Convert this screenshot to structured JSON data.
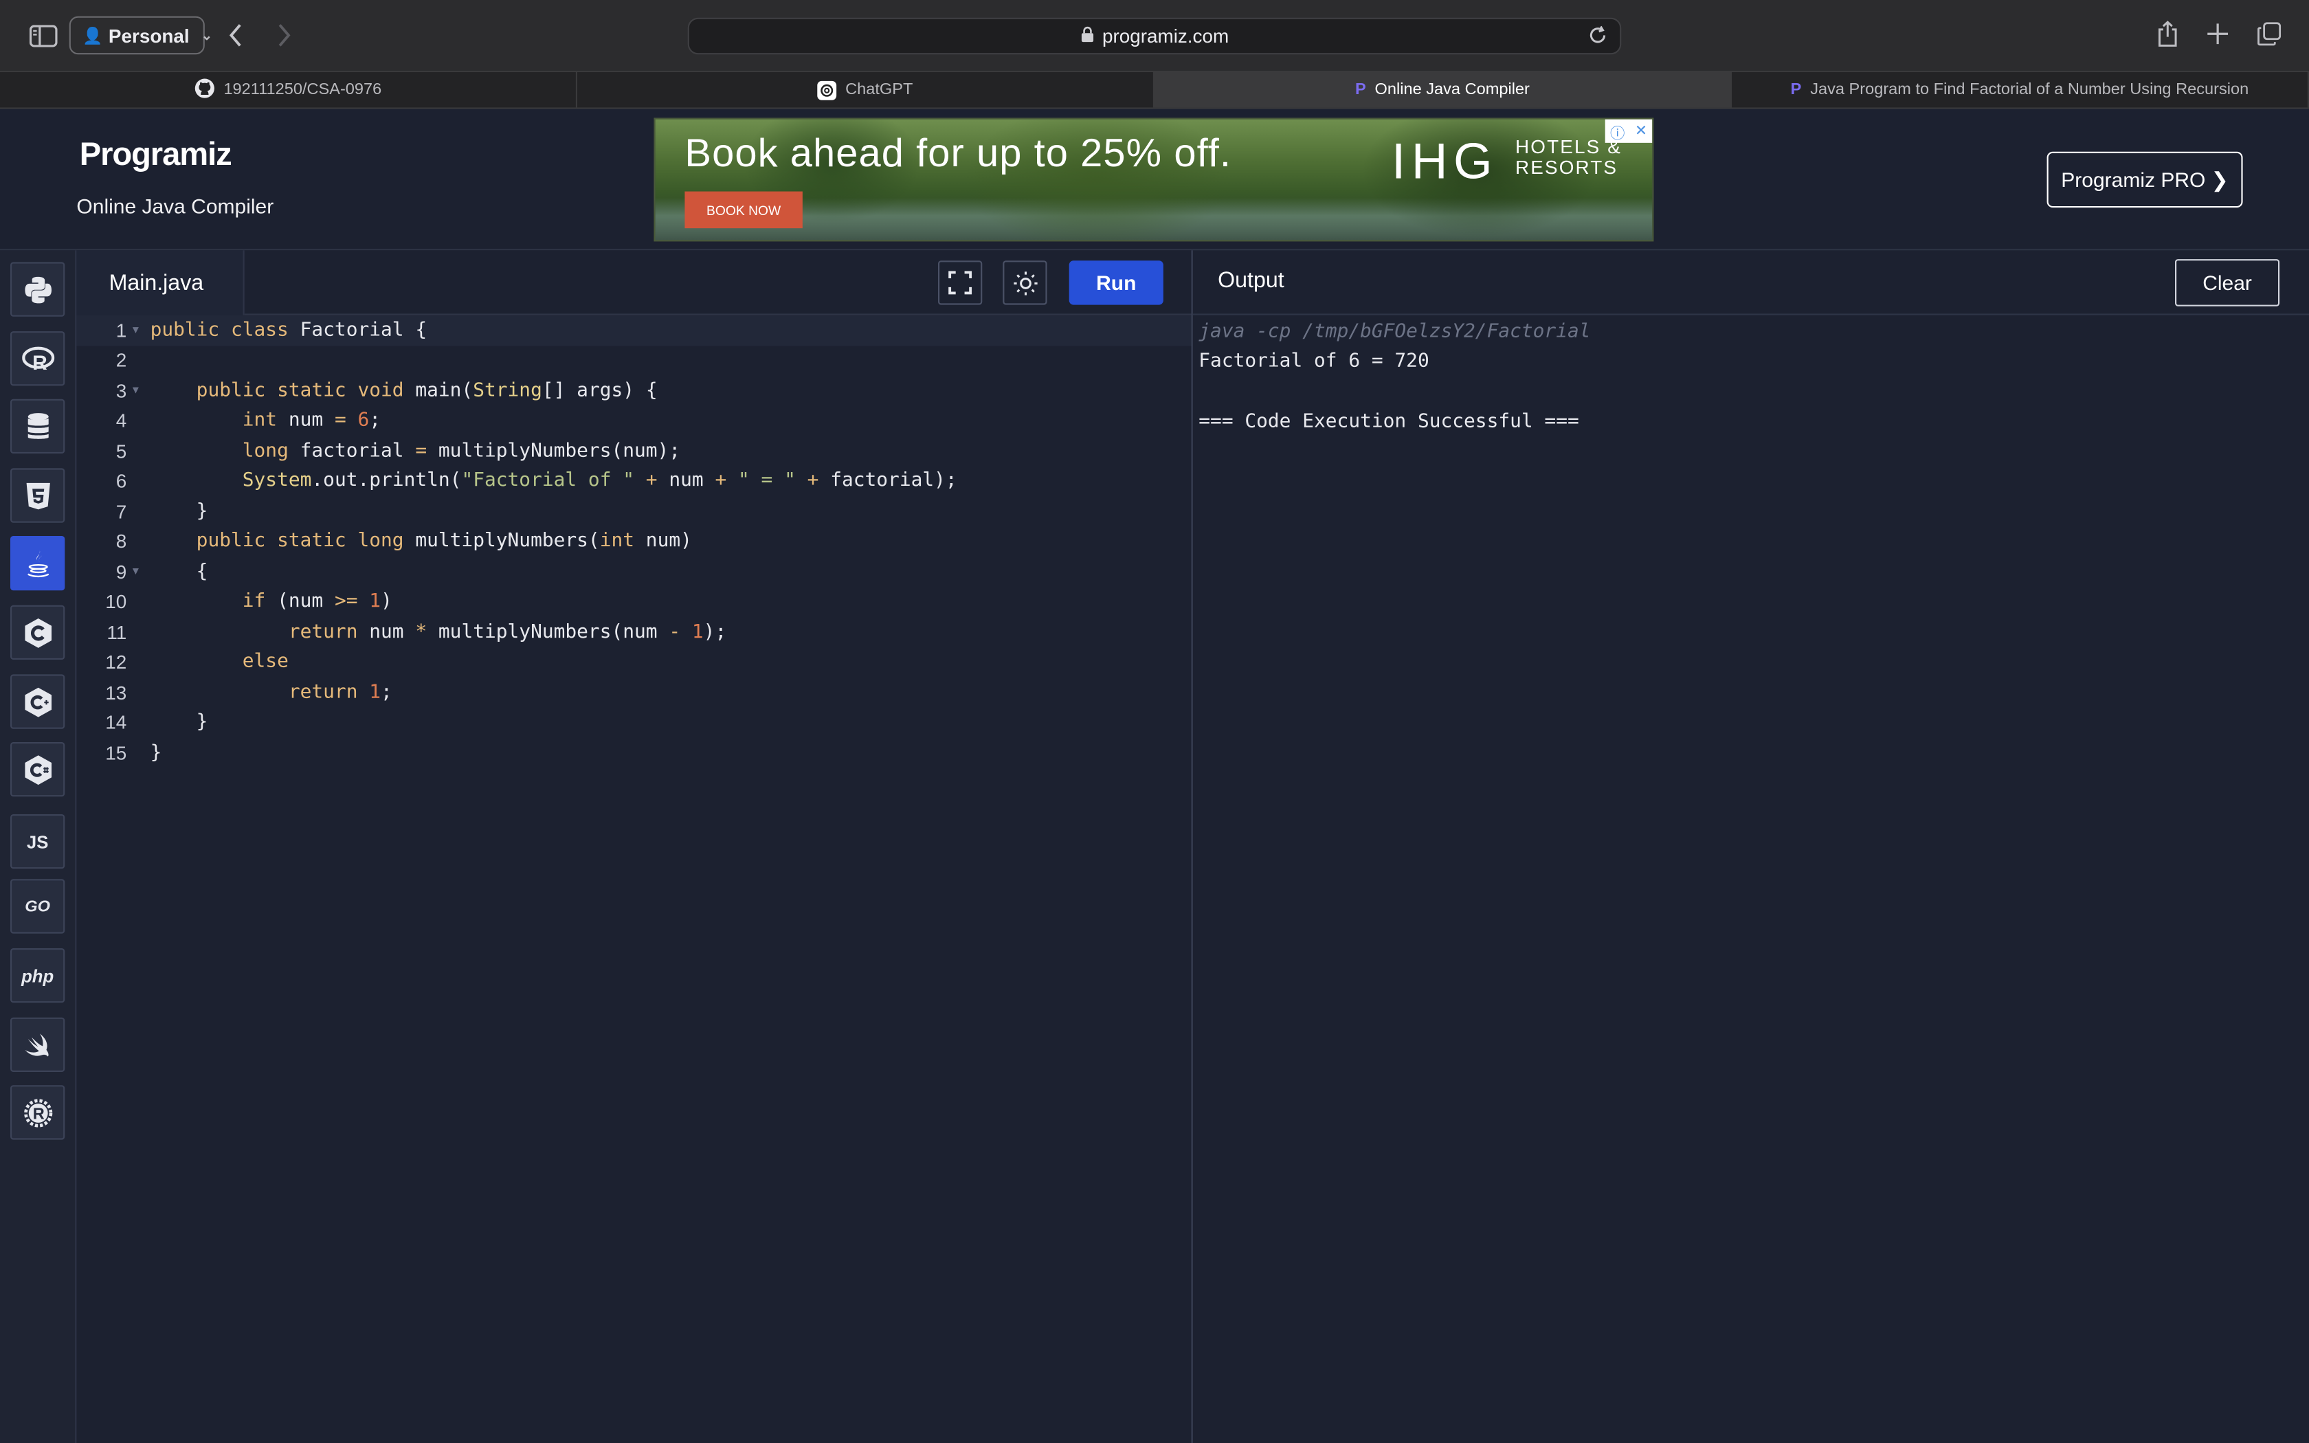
{
  "browser": {
    "profile_label": "Personal",
    "url": "programiz.com",
    "tabs": [
      {
        "label": "192111250/CSA-0976",
        "icon": "github-icon"
      },
      {
        "label": "ChatGPT",
        "icon": "chatgpt-icon"
      },
      {
        "label": "Online Java Compiler",
        "icon": "programiz-icon",
        "active": true
      },
      {
        "label": "Java Program to Find Factorial of a Number Using Recursion",
        "icon": "programiz-icon"
      }
    ]
  },
  "header": {
    "logo": "Programiz",
    "subtitle": "Online Java Compiler",
    "pro_button": "Programiz PRO ❯"
  },
  "ad": {
    "headline": "Book ahead for up to 25% off.",
    "brand": "IHG",
    "brand_sub_1": "HOTELS &",
    "brand_sub_2": "RESORTS",
    "cta": "BOOK NOW"
  },
  "sidebar": {
    "languages": [
      {
        "name": "python-icon",
        "glyph": "🐍"
      },
      {
        "name": "r-icon",
        "glyph": "R"
      },
      {
        "name": "sql-icon",
        "glyph": "⛁"
      },
      {
        "name": "html5-icon",
        "glyph": "5"
      },
      {
        "name": "java-icon",
        "glyph": "☕",
        "active": true
      },
      {
        "name": "c-icon",
        "glyph": "C"
      },
      {
        "name": "cpp-icon",
        "glyph": "C"
      },
      {
        "name": "csharp-icon",
        "glyph": "C"
      },
      {
        "name": "javascript-icon",
        "glyph": "JS"
      },
      {
        "name": "go-icon",
        "glyph": "GO"
      },
      {
        "name": "php-icon",
        "glyph": "php"
      },
      {
        "name": "swift-icon",
        "glyph": "➹"
      },
      {
        "name": "rust-icon",
        "glyph": "®"
      }
    ]
  },
  "editor": {
    "file_name": "Main.java",
    "run_label": "Run",
    "lines": [
      {
        "n": "1",
        "fold": true
      },
      {
        "n": "2"
      },
      {
        "n": "3",
        "fold": true
      },
      {
        "n": "4"
      },
      {
        "n": "5"
      },
      {
        "n": "6"
      },
      {
        "n": "7"
      },
      {
        "n": "8"
      },
      {
        "n": "9",
        "fold": true
      },
      {
        "n": "10"
      },
      {
        "n": "11"
      },
      {
        "n": "12"
      },
      {
        "n": "13"
      },
      {
        "n": "14"
      },
      {
        "n": "15"
      }
    ],
    "code": {
      "l1_kw": "public class",
      "l1_rest": " Factorial {",
      "l3_kw": "public static void",
      "l3_rest": " main(",
      "l3_cls": "String",
      "l3_rest2": "[] args) {",
      "l4_kw": "int",
      "l4_rest": " num ",
      "l4_op": "=",
      "l4_num": " 6",
      "l4_end": ";",
      "l5_kw": "long",
      "l5_rest": " factorial ",
      "l5_op": "=",
      "l5_rest2": " multiplyNumbers(num);",
      "l6_cls": "System",
      "l6_rest": ".out.println(",
      "l6_str1": "\"Factorial of \"",
      "l6_op1": " +",
      "l6_rest2": " num ",
      "l6_op2": "+",
      "l6_str2": " \" = \"",
      "l6_op3": " +",
      "l6_rest3": " factorial);",
      "l7": "}",
      "l8_kw": "public static long",
      "l8_rest": " multiplyNumbers(",
      "l8_kw2": "int",
      "l8_rest2": " num)",
      "l9": "{",
      "l10_kw": "if",
      "l10_rest": " (num ",
      "l10_op": ">=",
      "l10_num": " 1",
      "l10_end": ")",
      "l11_kw": "return",
      "l11_rest": " num ",
      "l11_op": "*",
      "l11_rest2": " multiplyNumbers(num ",
      "l11_op2": "-",
      "l11_num": " 1",
      "l11_end": ");",
      "l12_kw": "else",
      "l13_kw": "return",
      "l13_num": " 1",
      "l13_end": ";",
      "l14": "}",
      "l15": "}"
    }
  },
  "output": {
    "title": "Output",
    "clear_label": "Clear",
    "command": "java -cp /tmp/bGFOelzsY2/Factorial",
    "result": "Factorial of 6 = 720",
    "status": "=== Code Execution Successful ==="
  },
  "colors": {
    "background": "#1c2130",
    "run_button": "#2750d8",
    "keyword": "#e5b97a",
    "number": "#e07e52",
    "string": "#b7c58a"
  }
}
